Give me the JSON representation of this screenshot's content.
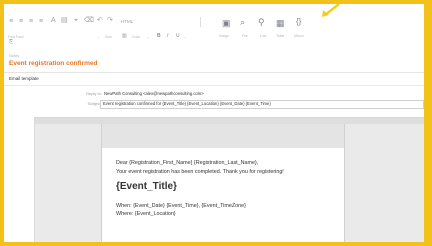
{
  "colors": {
    "frame": "#f2c21b",
    "accent": "#e8752b",
    "arrow": "#f5cd1e"
  },
  "toolbar": {
    "font_label": "Font Fami",
    "size_label": "Size",
    "color_label": "Color",
    "image_label": "Image",
    "file_label": "File",
    "link_label": "Link",
    "table_label": "Table",
    "macro_label": "Macro",
    "html_label": "HTML",
    "macro_glyph": "{}"
  },
  "header": {
    "breadcrumb": "Notify",
    "title": "Event registration confirmed",
    "template_label": "Email template"
  },
  "fields": {
    "reply_to_label": "Reply to:",
    "reply_to_value": "NewPath Consulting <alex@newpathconsulting.com>",
    "subject_label": "Subject:",
    "subject_value": "Event registration confirmed for {Event_Title} {Event_Location} {Event_Date} {Event_Time}"
  },
  "email": {
    "greeting": "Dear {Registration_First_Name} {Registration_Last_Name},",
    "intro": "Your event registration has been completed. Thank you for registering!",
    "event_title": "{Event_Title}",
    "when": "When: {Event_Date} {Event_Time}, {Event_TimeZone}",
    "where": "Where: {Event_Location}"
  }
}
